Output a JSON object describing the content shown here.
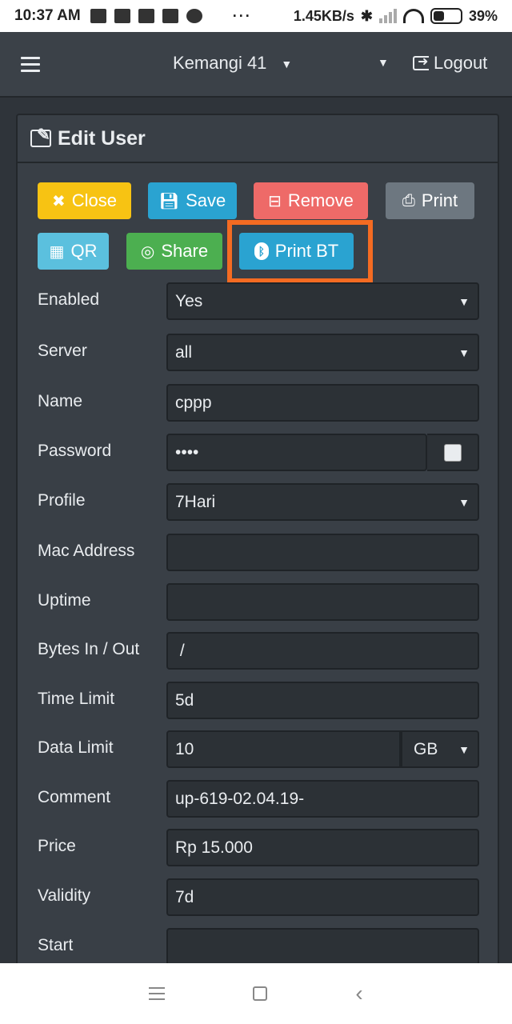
{
  "status_bar": {
    "time": "10:37 AM",
    "dots": "···",
    "speed": "1.45KB/s",
    "battery": "39%",
    "battery_level": 0.39
  },
  "navbar": {
    "router_name": "Kemangi 41",
    "logout_label": "Logout"
  },
  "card": {
    "title": "Edit User"
  },
  "buttons": {
    "close": "Close",
    "save": "Save",
    "remove": "Remove",
    "print": "Print",
    "qr": "QR",
    "share": "Share",
    "print_bt": "Print BT"
  },
  "form": {
    "enabled": {
      "label": "Enabled",
      "value": "Yes"
    },
    "server": {
      "label": "Server",
      "value": "all"
    },
    "name": {
      "label": "Name",
      "value": "cppp"
    },
    "password": {
      "label": "Password",
      "value": "••••"
    },
    "profile": {
      "label": "Profile",
      "value": "7Hari"
    },
    "mac_address": {
      "label": "Mac Address",
      "value": ""
    },
    "uptime": {
      "label": "Uptime",
      "value": ""
    },
    "bytes": {
      "label": "Bytes In / Out",
      "value": " /"
    },
    "time_limit": {
      "label": "Time Limit",
      "value": "5d"
    },
    "data_limit": {
      "label": "Data Limit",
      "value": "10",
      "unit": "GB"
    },
    "comment": {
      "label": "Comment",
      "value": "up-619-02.04.19-"
    },
    "price": {
      "label": "Price",
      "value": "Rp 15.000"
    },
    "validity": {
      "label": "Validity",
      "value": "7d"
    },
    "start": {
      "label": "Start",
      "value": ""
    }
  },
  "colors": {
    "close": "#f7c313",
    "save": "#2aa3d1",
    "remove": "#ee6a68",
    "print": "#6d7780",
    "qr": "#5bc0de",
    "share": "#4caf50",
    "highlight": "#f46b22"
  }
}
